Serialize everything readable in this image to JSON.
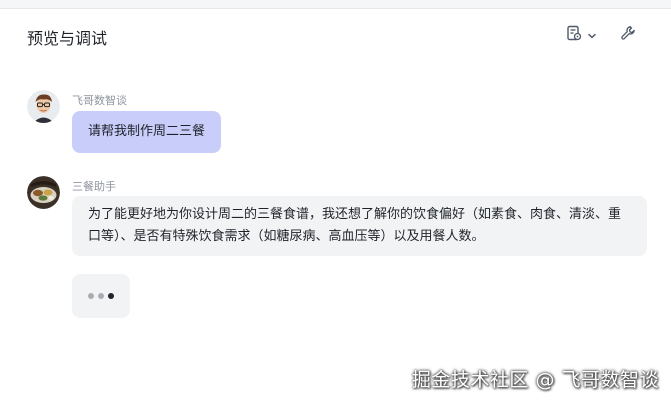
{
  "header": {
    "title": "预览与调试",
    "doc_button_icon": "document-settings-icon",
    "dropdown_icon": "chevron-down-icon",
    "tool_icon": "wrench-icon"
  },
  "messages": [
    {
      "sender": "飞哥数智谈",
      "role": "user",
      "avatar_icon": "user-avatar",
      "text": "请帮我制作周二三餐"
    },
    {
      "sender": "三餐助手",
      "role": "bot",
      "avatar_icon": "bot-avatar",
      "text": "为了能更好地为你设计周二的三餐食谱，我还想了解你的饮食偏好（如素食、肉食、清淡、重口等）、是否有特殊饮食需求（如糖尿病、高血压等）以及用餐人数。"
    }
  ],
  "typing_indicator": {
    "dots": 3,
    "active_dot": 3
  },
  "watermark": "掘金技术社区 @ 飞哥数智谈",
  "colors": {
    "user_bubble": "#c9cdfa",
    "bot_bubble": "#f2f3f5",
    "sender_text": "#8f959e"
  }
}
